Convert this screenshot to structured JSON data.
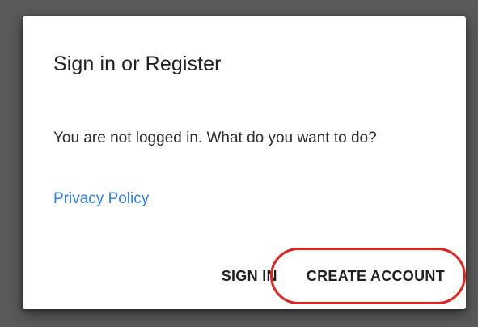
{
  "dialog": {
    "title": "Sign in or Register",
    "message": "You are not logged in. What do you want to do?",
    "privacy_link": "Privacy Policy",
    "buttons": {
      "sign_in": "SIGN IN",
      "create_account": "CREATE ACCOUNT"
    }
  },
  "colors": {
    "backdrop": "#5a5a5a",
    "link": "#2f80ed",
    "highlight": "#e6201a"
  }
}
